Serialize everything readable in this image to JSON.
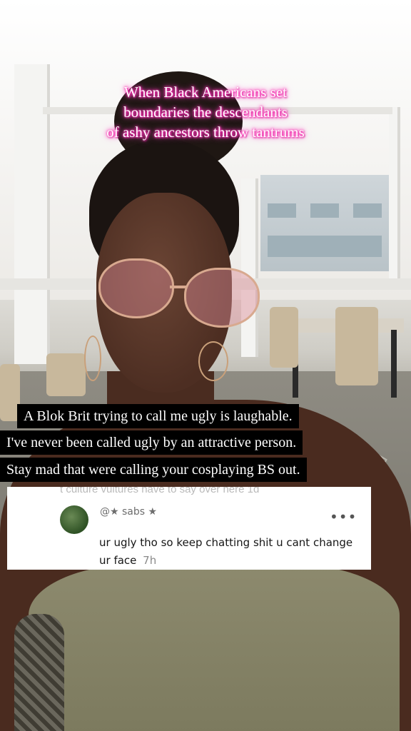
{
  "overlay_title": {
    "lines": [
      "When Black Americans set",
      "boundaries the descendants",
      "of ashy ancestors throw tantrums"
    ]
  },
  "captions": [
    "A Blok Brit trying to call me ugly is laughable.",
    "I've never been called ugly by an attractive person.",
    "Stay mad that were calling your cosplaying BS out."
  ],
  "comment": {
    "partial_line": "t culture vultures have to say over here 1d",
    "username": "@★ sabs ★",
    "text": "ur ugly tho so keep chatting shit u cant change ur face",
    "time": "7h",
    "more_icon": "more-horizontal-icon"
  },
  "colors": {
    "title_glow": "#ff2fb4",
    "caption_bg": "#000000",
    "comment_bg": "#ffffff"
  }
}
